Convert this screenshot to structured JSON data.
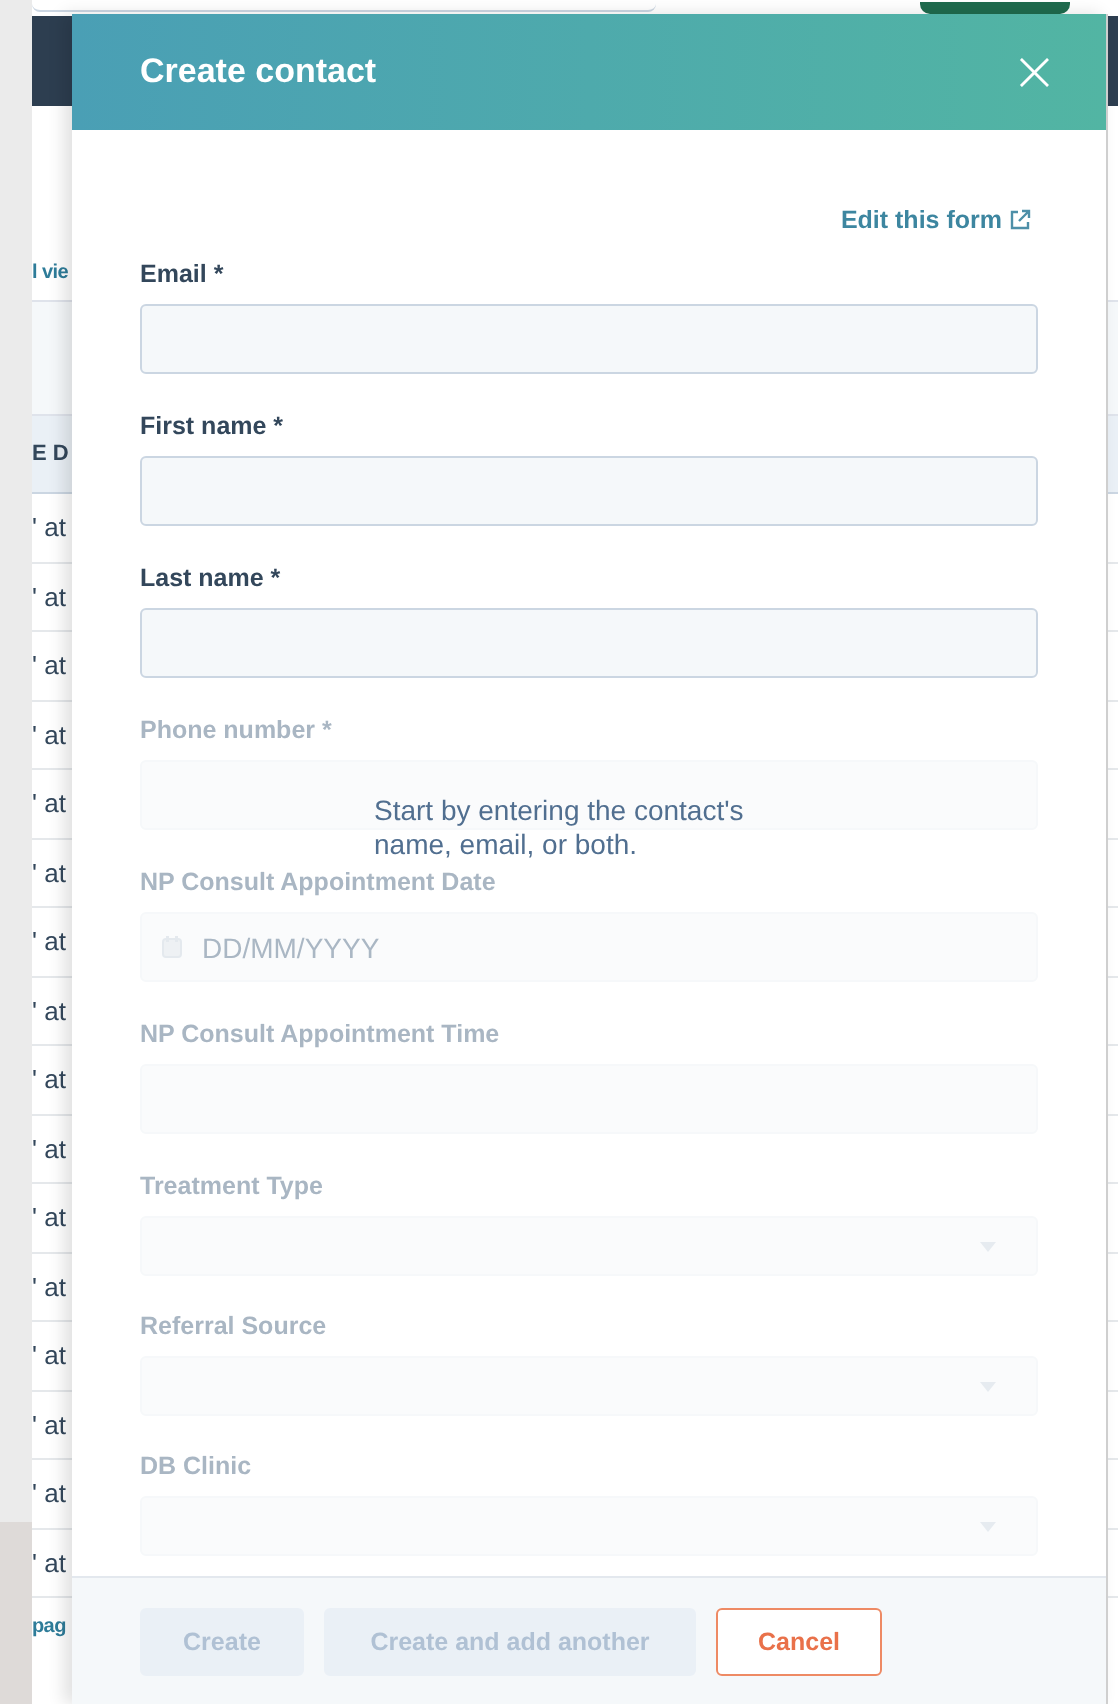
{
  "background": {
    "link_top": "l vie",
    "column_header": "E D",
    "rows": [
      "' at",
      "' at",
      "' at",
      "' at",
      "' at",
      "' at",
      "' at",
      "' at",
      "' at",
      "' at",
      "' at",
      "' at",
      "' at",
      "' at",
      "' at",
      "' at"
    ],
    "link_bottom": "pag"
  },
  "dialog": {
    "title": "Create contact",
    "close": "×",
    "edit_link": "Edit this form",
    "fields": [
      {
        "kind": "text",
        "label": "Email *",
        "disabled": false
      },
      {
        "kind": "text",
        "label": "First name *",
        "disabled": false
      },
      {
        "kind": "text",
        "label": "Last name *",
        "disabled": false
      },
      {
        "kind": "text",
        "label": "Phone number *",
        "disabled": true
      },
      {
        "kind": "date",
        "label": "NP Consult Appointment Date",
        "placeholder": "DD/MM/YYYY",
        "disabled": true
      },
      {
        "kind": "text",
        "label": "NP Consult Appointment Time",
        "disabled": true
      },
      {
        "kind": "select",
        "label": "Treatment Type",
        "disabled": true
      },
      {
        "kind": "select",
        "label": "Referral Source",
        "disabled": true
      },
      {
        "kind": "select",
        "label": "DB Clinic",
        "disabled": true
      }
    ],
    "hint": "Start by entering the contact's name, email, or both.",
    "buttons": [
      {
        "kind": "primary",
        "label": "Create",
        "disabled": true
      },
      {
        "kind": "secondary",
        "label": "Create and add another",
        "disabled": true
      },
      {
        "kind": "cancel",
        "label": "Cancel",
        "disabled": false
      }
    ]
  }
}
